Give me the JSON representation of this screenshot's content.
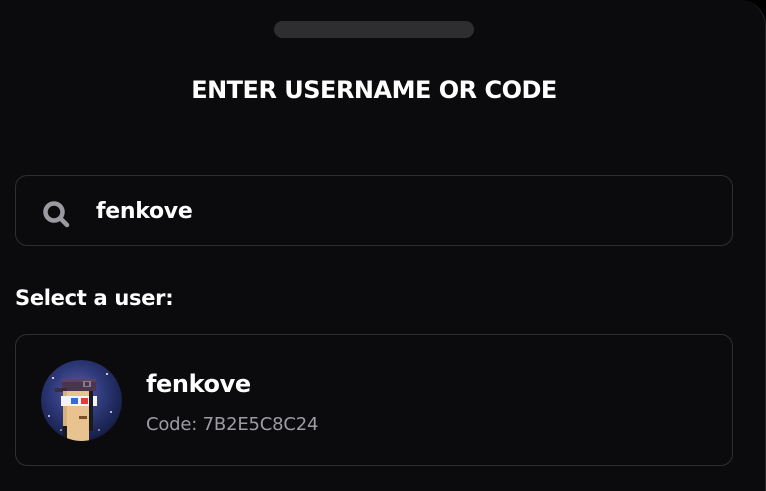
{
  "sheet": {
    "title": "ENTER USERNAME OR CODE"
  },
  "search": {
    "icon": "search-icon",
    "value": "fenkove",
    "placeholder": ""
  },
  "results": {
    "label": "Select a user:",
    "users": [
      {
        "username": "fenkove",
        "code": "Code: 7B2E5C8C24",
        "avatar": "pixel-avatar-icon"
      }
    ]
  },
  "colors": {
    "background": "#0b0b0d",
    "border": "#2f2f33",
    "text": "#ffffff",
    "muted": "#9c9ca3"
  }
}
